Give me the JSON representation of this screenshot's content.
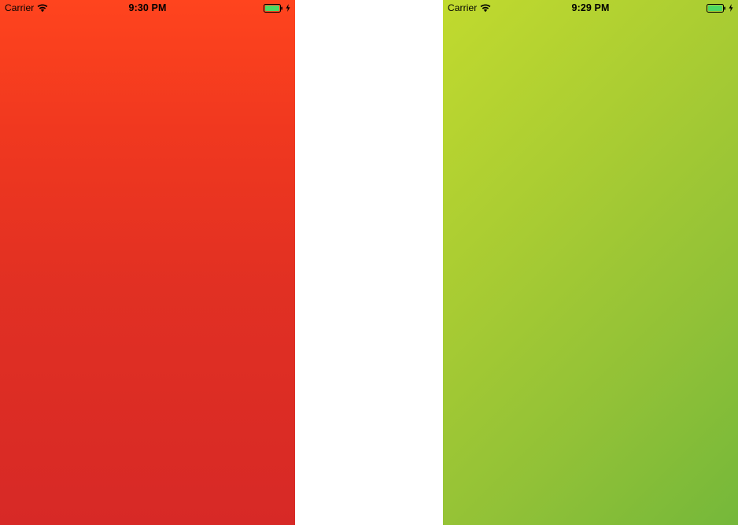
{
  "screens": [
    {
      "carrier": "Carrier",
      "time": "9:30 PM",
      "battery_level": 1.0,
      "charging": true,
      "icons": [
        "wifi-icon",
        "battery-icon",
        "charging-bolt-icon"
      ],
      "background": {
        "type": "vertical-gradient",
        "colors": [
          "#FF441E",
          "#D72926"
        ]
      }
    },
    {
      "carrier": "Carrier",
      "time": "9:29 PM",
      "battery_level": 1.0,
      "charging": true,
      "icons": [
        "wifi-icon",
        "battery-icon",
        "charging-bolt-icon"
      ],
      "background": {
        "type": "diagonal-gradient",
        "colors": [
          "#C1DA2E",
          "#75B83A"
        ]
      }
    }
  ],
  "colors": {
    "battery_fill": "#4CD964",
    "status_text": "#000000"
  }
}
